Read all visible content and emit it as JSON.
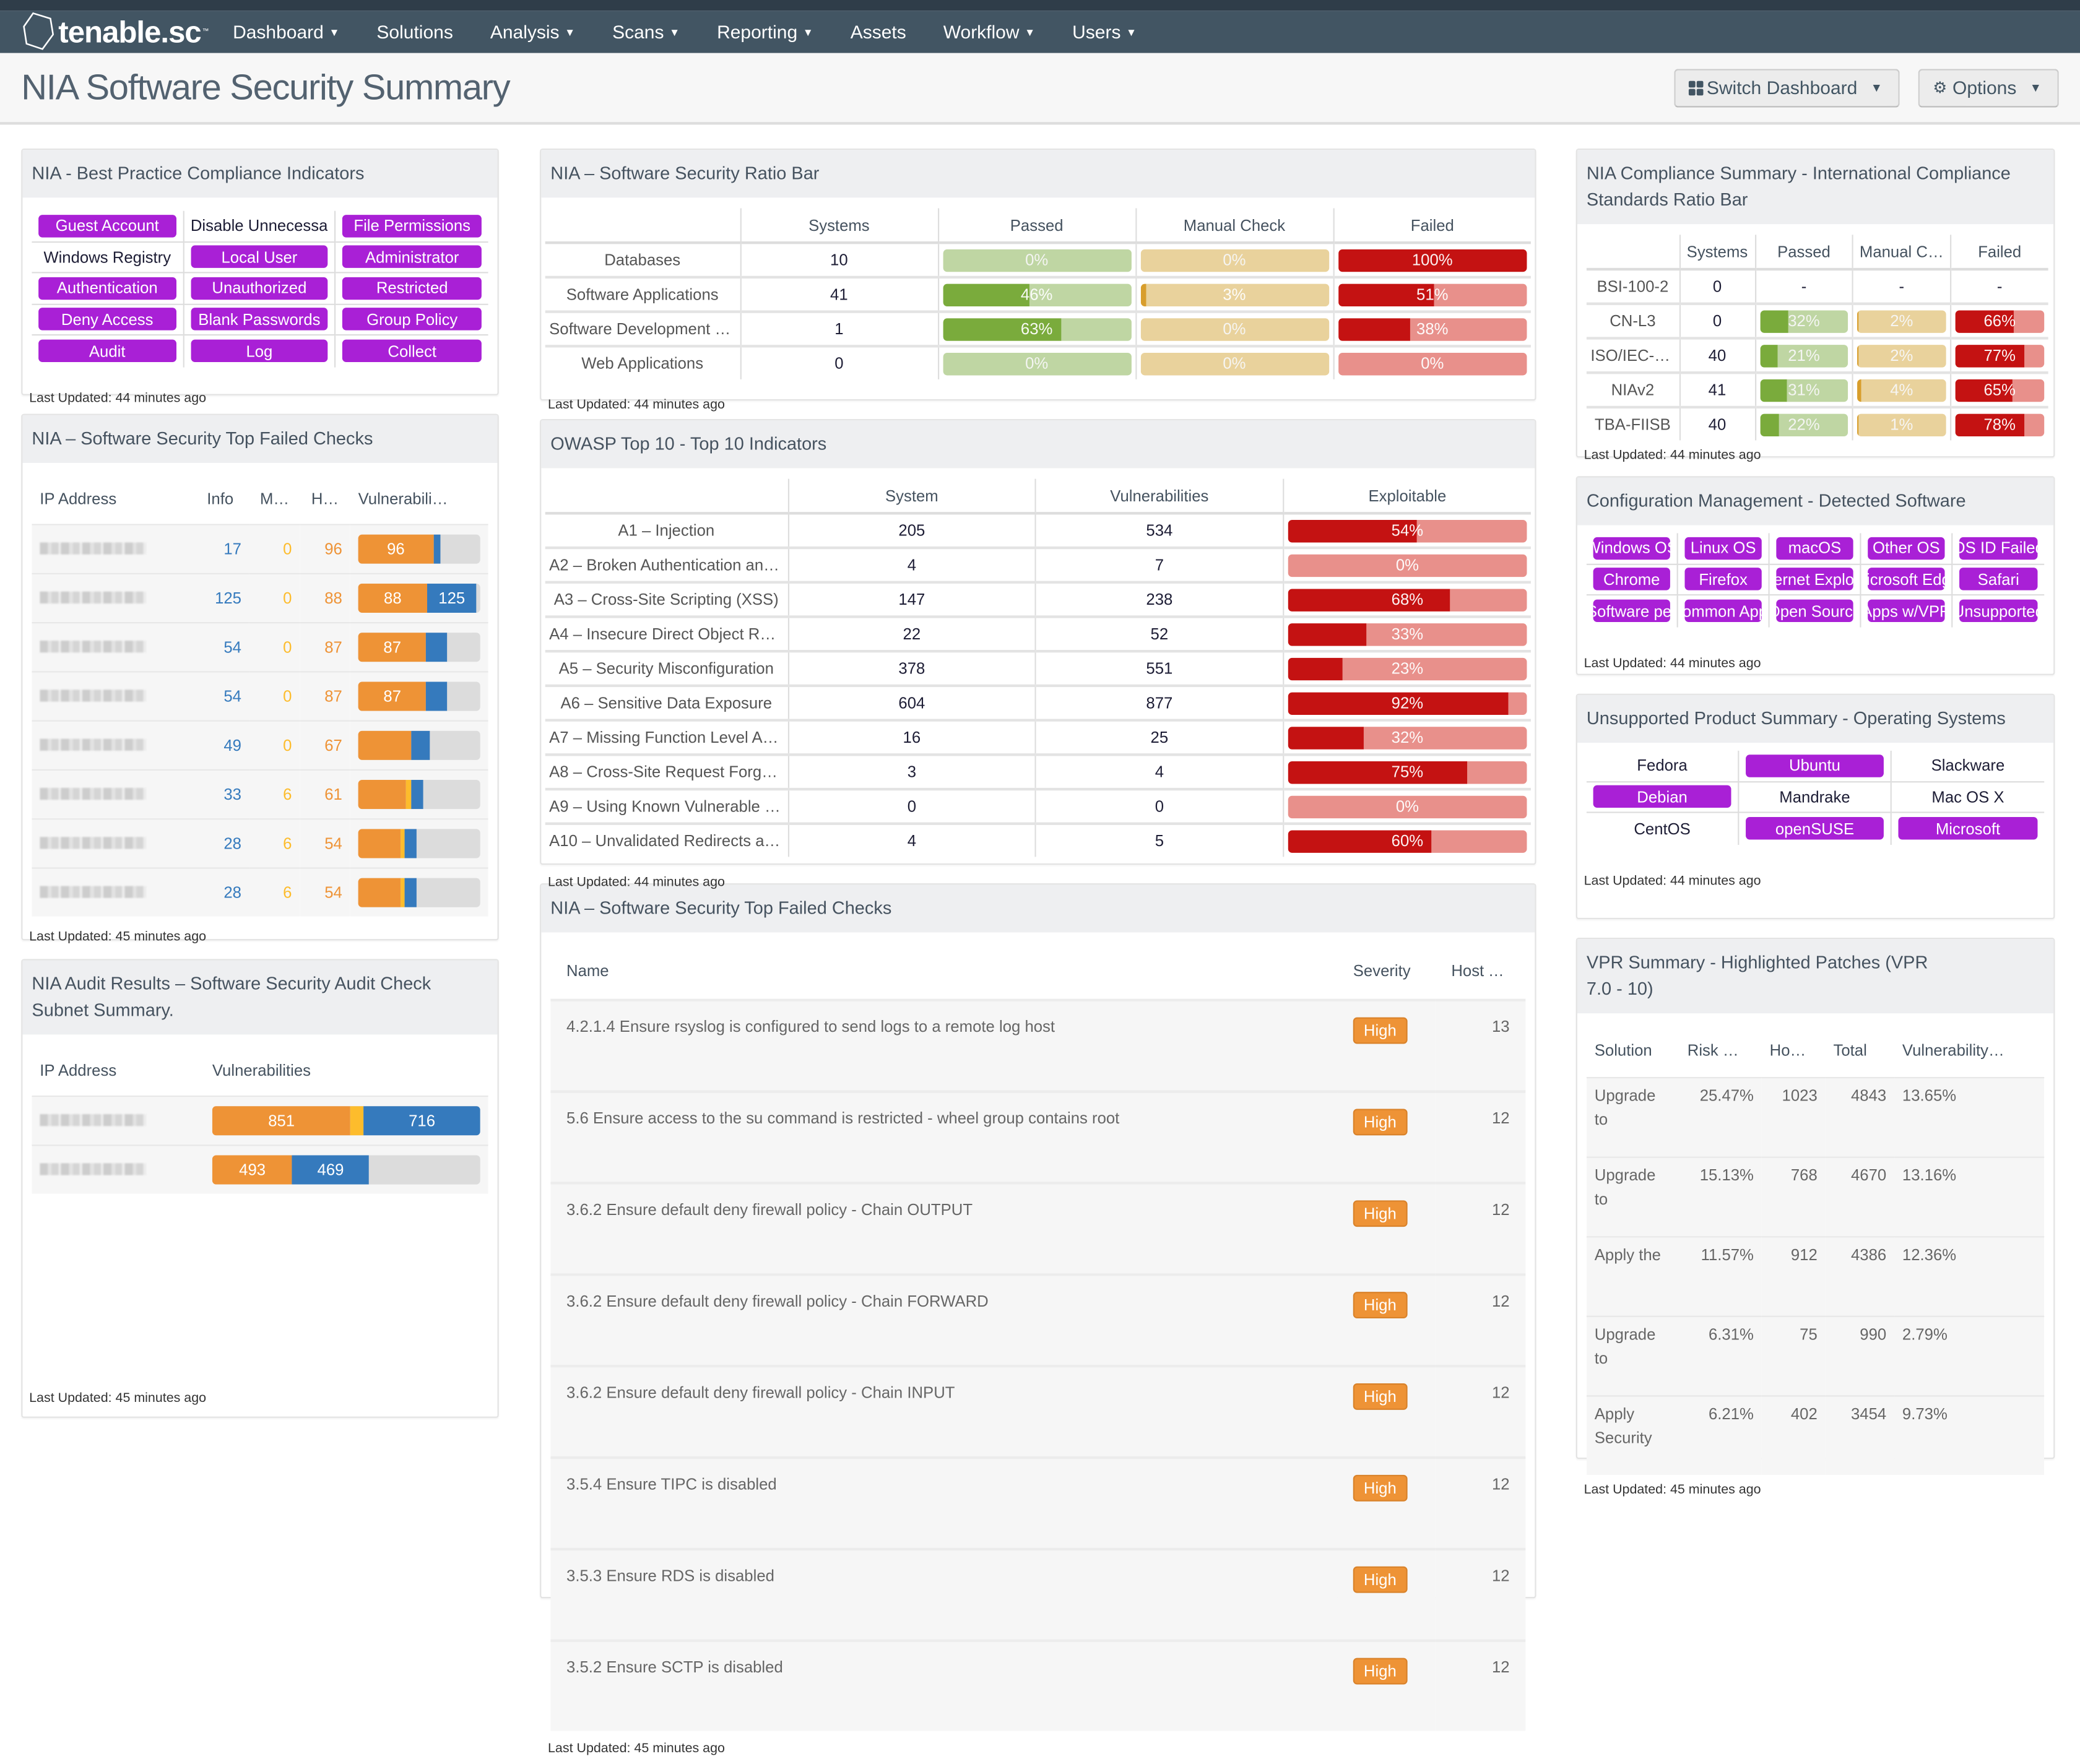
{
  "app": {
    "brand": "tenable.sc",
    "nav": [
      {
        "label": "Dashboard",
        "dropdown": true
      },
      {
        "label": "Solutions",
        "dropdown": false
      },
      {
        "label": "Analysis",
        "dropdown": true
      },
      {
        "label": "Scans",
        "dropdown": true
      },
      {
        "label": "Reporting",
        "dropdown": true
      },
      {
        "label": "Assets",
        "dropdown": false
      },
      {
        "label": "Workflow",
        "dropdown": true
      },
      {
        "label": "Users",
        "dropdown": true
      }
    ]
  },
  "header": {
    "title": "NIA Software Security Summary",
    "switch_dashboard": "Switch Dashboard",
    "options": "Options"
  },
  "colors": {
    "nav_bg": "#425563",
    "badge_purple": "#a920d6",
    "passed": "#7aab3c",
    "passed_light": "#bfd6a3",
    "manual": "#d89e2c",
    "manual_light": "#e9d29c",
    "failed": "#c41212",
    "failed_light": "#e8908b",
    "info": "#357abd",
    "medium": "#fdbc2c",
    "high": "#ee9336"
  },
  "compliance_indicators": {
    "title": "NIA - Best Practice Compliance Indicators",
    "items": [
      {
        "label": "Guest Account",
        "highlighted": true
      },
      {
        "label": "Disable Unnecessary",
        "highlighted": false
      },
      {
        "label": "File Permissions",
        "highlighted": true
      },
      {
        "label": "Windows Registry",
        "highlighted": false
      },
      {
        "label": "Local User",
        "highlighted": true
      },
      {
        "label": "Administrator",
        "highlighted": true
      },
      {
        "label": "Authentication",
        "highlighted": true
      },
      {
        "label": "Unauthorized",
        "highlighted": true
      },
      {
        "label": "Restricted",
        "highlighted": true
      },
      {
        "label": "Deny Access",
        "highlighted": true
      },
      {
        "label": "Blank Passwords",
        "highlighted": true
      },
      {
        "label": "Group Policy",
        "highlighted": true
      },
      {
        "label": "Audit",
        "highlighted": true
      },
      {
        "label": "Log",
        "highlighted": true
      },
      {
        "label": "Collect",
        "highlighted": true
      }
    ],
    "updated": "Last Updated: 44 minutes ago"
  },
  "top_failed_left": {
    "title": "NIA – Software Security Top Failed Checks",
    "columns": [
      "IP Address",
      "Info",
      "M…",
      "H…",
      "Vulnerabili…"
    ],
    "rows": [
      {
        "ip": "(redacted)",
        "info": 17,
        "medium": 0,
        "high": 96,
        "bar_label_high": "96",
        "bar_label_info": ""
      },
      {
        "ip": "(redacted)",
        "info": 125,
        "medium": 0,
        "high": 88,
        "bar_label_high": "88",
        "bar_label_info": "125"
      },
      {
        "ip": "(redacted)",
        "info": 54,
        "medium": 0,
        "high": 87,
        "bar_label_high": "87",
        "bar_label_info": ""
      },
      {
        "ip": "(redacted)",
        "info": 54,
        "medium": 0,
        "high": 87,
        "bar_label_high": "87",
        "bar_label_info": ""
      },
      {
        "ip": "(redacted)",
        "info": 49,
        "medium": 0,
        "high": 67,
        "bar_label_high": "",
        "bar_label_info": ""
      },
      {
        "ip": "(redacted)",
        "info": 33,
        "medium": 6,
        "high": 61,
        "bar_label_high": "",
        "bar_label_info": ""
      },
      {
        "ip": "(redacted)",
        "info": 28,
        "medium": 6,
        "high": 54,
        "bar_label_high": "",
        "bar_label_info": ""
      },
      {
        "ip": "(redacted)",
        "info": 28,
        "medium": 6,
        "high": 54,
        "bar_label_high": "",
        "bar_label_info": ""
      }
    ],
    "updated": "Last Updated: 45 minutes ago"
  },
  "audit_results": {
    "title": "NIA Audit Results – Software Security Audit Check Subnet Summary.",
    "columns": [
      "IP Address",
      "Vulnerabilities"
    ],
    "rows": [
      {
        "ip": "(redacted)",
        "high": 851,
        "medium": 80,
        "info": 716,
        "bar_label_high": "851",
        "bar_label_info": "716"
      },
      {
        "ip": "(redacted)",
        "high": 493,
        "medium": 0,
        "info": 469,
        "bar_label_high": "493",
        "bar_label_info": "469"
      }
    ],
    "updated": "Last Updated: 45 minutes ago"
  },
  "ratio_bar": {
    "title": "NIA – Software Security Ratio Bar",
    "columns": [
      "",
      "Systems",
      "Passed",
      "Manual Check",
      "Failed"
    ],
    "rows": [
      {
        "label": "Databases",
        "systems": "10",
        "passed": 0,
        "manual": 0,
        "failed": 100,
        "passed_label": "0%",
        "manual_label": "0%",
        "failed_label": "100%"
      },
      {
        "label": "Software Applications",
        "systems": "41",
        "passed": 46,
        "manual": 3,
        "failed": 51,
        "passed_label": "46%",
        "manual_label": "3%",
        "failed_label": "51%"
      },
      {
        "label": "Software Development & …",
        "systems": "1",
        "passed": 63,
        "manual": 0,
        "failed": 38,
        "passed_label": "63%",
        "manual_label": "0%",
        "failed_label": "38%"
      },
      {
        "label": "Web Applications",
        "systems": "0",
        "passed": 0,
        "manual": 0,
        "failed": 0,
        "passed_label": "0%",
        "manual_label": "0%",
        "failed_label": "0%"
      }
    ],
    "updated": "Last Updated: 44 minutes ago"
  },
  "owasp": {
    "title": "OWASP Top 10 - Top 10 Indicators",
    "columns": [
      "",
      "System",
      "Vulnerabilities",
      "Exploitable"
    ],
    "rows": [
      {
        "label": "A1 – Injection",
        "system": "205",
        "vulns": "534",
        "exploitable": 54,
        "exploitable_label": "54%"
      },
      {
        "label": "A2 – Broken Authentication and …",
        "system": "4",
        "vulns": "7",
        "exploitable": 0,
        "exploitable_label": "0%"
      },
      {
        "label": "A3 – Cross-Site Scripting (XSS)",
        "system": "147",
        "vulns": "238",
        "exploitable": 68,
        "exploitable_label": "68%"
      },
      {
        "label": "A4 – Insecure Direct Object Refe…",
        "system": "22",
        "vulns": "52",
        "exploitable": 33,
        "exploitable_label": "33%"
      },
      {
        "label": "A5 – Security Misconfiguration",
        "system": "378",
        "vulns": "551",
        "exploitable": 23,
        "exploitable_label": "23%"
      },
      {
        "label": "A6 – Sensitive Data Exposure",
        "system": "604",
        "vulns": "877",
        "exploitable": 92,
        "exploitable_label": "92%"
      },
      {
        "label": "A7 – Missing Function Level Acc…",
        "system": "16",
        "vulns": "25",
        "exploitable": 32,
        "exploitable_label": "32%"
      },
      {
        "label": "A8 – Cross-Site Request Forger…",
        "system": "3",
        "vulns": "4",
        "exploitable": 75,
        "exploitable_label": "75%"
      },
      {
        "label": "A9 – Using Known Vulnerable C…",
        "system": "0",
        "vulns": "0",
        "exploitable": 0,
        "exploitable_label": "0%"
      },
      {
        "label": "A10 – Unvalidated Redirects an…",
        "system": "4",
        "vulns": "5",
        "exploitable": 60,
        "exploitable_label": "60%"
      }
    ],
    "updated": "Last Updated: 44 minutes ago"
  },
  "top_failed_mid": {
    "title": "NIA – Software Security Top Failed Checks",
    "columns": [
      "Name",
      "Severity",
      "Host Total"
    ],
    "rows": [
      {
        "name": "4.2.1.4 Ensure rsyslog is configured to send logs to a remote log host",
        "severity": "High",
        "hosts": "13"
      },
      {
        "name": "5.6 Ensure access to the su command is restricted - wheel group contains root",
        "severity": "High",
        "hosts": "12"
      },
      {
        "name": "3.6.2 Ensure default deny firewall policy - Chain OUTPUT",
        "severity": "High",
        "hosts": "12"
      },
      {
        "name": "3.6.2 Ensure default deny firewall policy - Chain FORWARD",
        "severity": "High",
        "hosts": "12"
      },
      {
        "name": "3.6.2 Ensure default deny firewall policy - Chain INPUT",
        "severity": "High",
        "hosts": "12"
      },
      {
        "name": "3.5.4 Ensure TIPC is disabled",
        "severity": "High",
        "hosts": "12"
      },
      {
        "name": "3.5.3 Ensure RDS is disabled",
        "severity": "High",
        "hosts": "12"
      },
      {
        "name": "3.5.2 Ensure SCTP is disabled",
        "severity": "High",
        "hosts": "12"
      }
    ],
    "updated": "Last Updated: 45 minutes ago"
  },
  "intl_compliance": {
    "title": "NIA Compliance Summary - International Compliance Standards Ratio Bar",
    "columns": [
      "",
      "Systems",
      "Passed",
      "Manual C…",
      "Failed"
    ],
    "rows": [
      {
        "label": "BSI-100-2",
        "systems": "0",
        "empty": true,
        "dash": "-"
      },
      {
        "label": "CN-L3",
        "systems": "0",
        "passed": 32,
        "manual": 2,
        "failed": 66,
        "passed_label": "32%",
        "manual_label": "2%",
        "failed_label": "66%"
      },
      {
        "label": "ISO/IEC-2…",
        "systems": "40",
        "passed": 21,
        "manual": 2,
        "failed": 77,
        "passed_label": "21%",
        "manual_label": "2%",
        "failed_label": "77%"
      },
      {
        "label": "NIAv2",
        "systems": "41",
        "passed": 31,
        "manual": 4,
        "failed": 65,
        "passed_label": "31%",
        "manual_label": "4%",
        "failed_label": "65%"
      },
      {
        "label": "TBA-FIISB",
        "systems": "40",
        "passed": 22,
        "manual": 1,
        "failed": 78,
        "passed_label": "22%",
        "manual_label": "1%",
        "failed_label": "78%"
      }
    ],
    "updated": "Last Updated: 44 minutes ago"
  },
  "detected_software": {
    "title": "Configuration Management - Detected Software",
    "items": [
      {
        "label": "Windows OS",
        "highlighted": true
      },
      {
        "label": "Linux OS",
        "highlighted": true
      },
      {
        "label": "macOS",
        "highlighted": true
      },
      {
        "label": "Other OS",
        "highlighted": true
      },
      {
        "label": "OS ID Failed",
        "highlighted": true
      },
      {
        "label": "Chrome",
        "highlighted": true
      },
      {
        "label": "Firefox",
        "highlighted": true
      },
      {
        "label": "Internet Explorer",
        "highlighted": true
      },
      {
        "label": "Microsoft Edge",
        "highlighted": true
      },
      {
        "label": "Safari",
        "highlighted": true
      },
      {
        "label": "Software per",
        "highlighted": true
      },
      {
        "label": "Common Apps",
        "highlighted": true
      },
      {
        "label": "Open Source",
        "highlighted": true
      },
      {
        "label": "Apps w/VPR",
        "highlighted": true
      },
      {
        "label": "Unsupported",
        "highlighted": true
      }
    ],
    "updated": "Last Updated: 44 minutes ago"
  },
  "unsupported_os": {
    "title": "Unsupported Product Summary - Operating Systems",
    "items": [
      {
        "label": "Fedora",
        "highlighted": false
      },
      {
        "label": "Ubuntu",
        "highlighted": true
      },
      {
        "label": "Slackware",
        "highlighted": false
      },
      {
        "label": "Debian",
        "highlighted": true
      },
      {
        "label": "Mandrake",
        "highlighted": false
      },
      {
        "label": "Mac OS X",
        "highlighted": false
      },
      {
        "label": "CentOS",
        "highlighted": false
      },
      {
        "label": "openSUSE",
        "highlighted": true
      },
      {
        "label": "Microsoft",
        "highlighted": true
      }
    ],
    "updated": "Last Updated: 44 minutes ago"
  },
  "vpr": {
    "title": "VPR Summary - Highlighted Patches (VPR 7.0 - 10)",
    "columns": [
      "Solution",
      "Risk …",
      "Ho…",
      "Total",
      "Vulnerability…"
    ],
    "rows": [
      {
        "solution": "Upgrade to",
        "risk": "25.47%",
        "hosts": "1023",
        "total": "4843",
        "vuln": "13.65%"
      },
      {
        "solution": "Upgrade to",
        "risk": "15.13%",
        "hosts": "768",
        "total": "4670",
        "vuln": "13.16%"
      },
      {
        "solution": "Apply the",
        "risk": "11.57%",
        "hosts": "912",
        "total": "4386",
        "vuln": "12.36%"
      },
      {
        "solution": "Upgrade to",
        "risk": "6.31%",
        "hosts": "75",
        "total": "990",
        "vuln": "2.79%"
      },
      {
        "solution": "Apply Security",
        "risk": "6.21%",
        "hosts": "402",
        "total": "3454",
        "vuln": "9.73%"
      }
    ],
    "updated": "Last Updated: 45 minutes ago"
  }
}
